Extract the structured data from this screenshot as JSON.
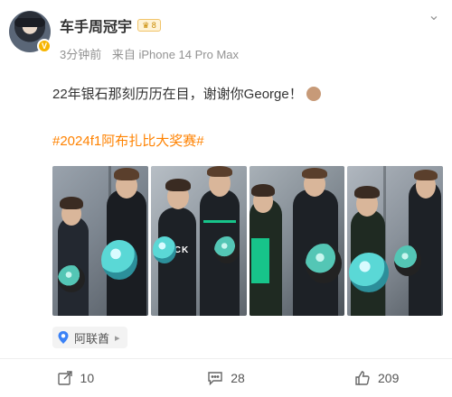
{
  "user": {
    "name": "车手周冠宇",
    "badge_icon": "crown-icon",
    "meta_time": "3分钟前",
    "meta_source": "来自 iPhone 14 Pro Max"
  },
  "post": {
    "text": "22年银石那刻历历在目，谢谢你George！",
    "emoji_icon": "fist-emoji-icon",
    "hashtag": "#2024f1阿布扎比大奖赛#"
  },
  "photos": [
    {
      "name": "photo-1"
    },
    {
      "name": "photo-2"
    },
    {
      "name": "photo-3"
    },
    {
      "name": "photo-4"
    }
  ],
  "location": {
    "label": "阿联酋",
    "icon": "location-pin-icon"
  },
  "actions": {
    "share_count": "10",
    "comment_count": "28",
    "like_count": "209"
  },
  "colors": {
    "hashtag": "#ff8200",
    "badge": "#f7b500",
    "location_pin": "#3b82f6"
  }
}
